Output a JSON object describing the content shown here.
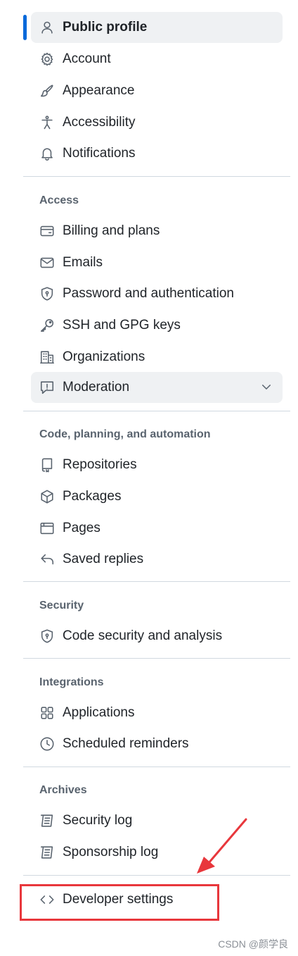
{
  "nav": {
    "items": [
      {
        "label": "Public profile",
        "icon": "person-icon"
      },
      {
        "label": "Account",
        "icon": "gear-icon"
      },
      {
        "label": "Appearance",
        "icon": "paintbrush-icon"
      },
      {
        "label": "Accessibility",
        "icon": "accessibility-icon"
      },
      {
        "label": "Notifications",
        "icon": "bell-icon"
      }
    ]
  },
  "sections": {
    "access": {
      "title": "Access",
      "items": [
        {
          "label": "Billing and plans",
          "icon": "credit-card-icon"
        },
        {
          "label": "Emails",
          "icon": "mail-icon"
        },
        {
          "label": "Password and authentication",
          "icon": "shield-lock-icon"
        },
        {
          "label": "SSH and GPG keys",
          "icon": "key-icon"
        },
        {
          "label": "Organizations",
          "icon": "organization-icon"
        },
        {
          "label": "Moderation",
          "icon": "report-icon"
        }
      ]
    },
    "code": {
      "title": "Code, planning, and automation",
      "items": [
        {
          "label": "Repositories",
          "icon": "repo-icon"
        },
        {
          "label": "Packages",
          "icon": "package-icon"
        },
        {
          "label": "Pages",
          "icon": "browser-icon"
        },
        {
          "label": "Saved replies",
          "icon": "reply-icon"
        }
      ]
    },
    "security": {
      "title": "Security",
      "items": [
        {
          "label": "Code security and analysis",
          "icon": "shield-lock-icon"
        }
      ]
    },
    "integrations": {
      "title": "Integrations",
      "items": [
        {
          "label": "Applications",
          "icon": "apps-icon"
        },
        {
          "label": "Scheduled reminders",
          "icon": "clock-icon"
        }
      ]
    },
    "archives": {
      "title": "Archives",
      "items": [
        {
          "label": "Security log",
          "icon": "log-icon"
        },
        {
          "label": "Sponsorship log",
          "icon": "log-icon"
        }
      ]
    }
  },
  "developer": {
    "label": "Developer settings",
    "icon": "code-icon"
  },
  "annotation": {
    "highlight_color": "#e8373c"
  },
  "watermark": "CSDN @颜学良",
  "colors": {
    "accent": "#0969da",
    "active_bg": "#eff1f3"
  }
}
